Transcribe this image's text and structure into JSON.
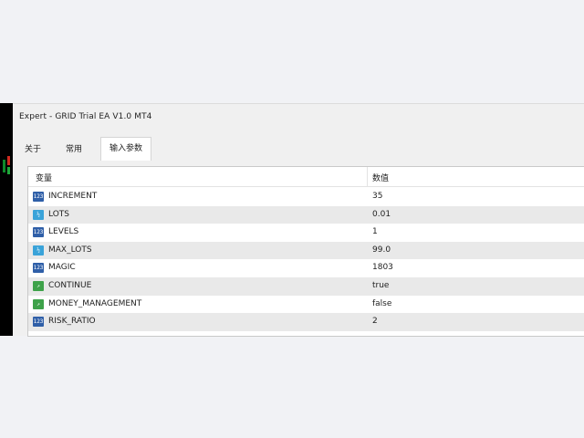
{
  "window": {
    "title": "Expert - GRID Trial EA V1.0 MT4"
  },
  "tabs": [
    {
      "label": "关于"
    },
    {
      "label": "常用"
    },
    {
      "label": "输入参数"
    }
  ],
  "table": {
    "headers": {
      "variable": "变量",
      "value": "数值"
    },
    "rows": [
      {
        "icon": "int-type-icon",
        "name": "INCREMENT",
        "value": "35"
      },
      {
        "icon": "double-type-icon",
        "name": "LOTS",
        "value": "0.01"
      },
      {
        "icon": "int-type-icon",
        "name": "LEVELS",
        "value": "1"
      },
      {
        "icon": "double-type-icon",
        "name": "MAX_LOTS",
        "value": "99.0"
      },
      {
        "icon": "int-type-icon",
        "name": "MAGIC",
        "value": "1803"
      },
      {
        "icon": "bool-type-icon",
        "name": "CONTINUE",
        "value": "true"
      },
      {
        "icon": "bool-type-icon",
        "name": "MONEY_MANAGEMENT",
        "value": "false"
      },
      {
        "icon": "int-type-icon",
        "name": "RISK_RATIO",
        "value": "2"
      }
    ]
  }
}
